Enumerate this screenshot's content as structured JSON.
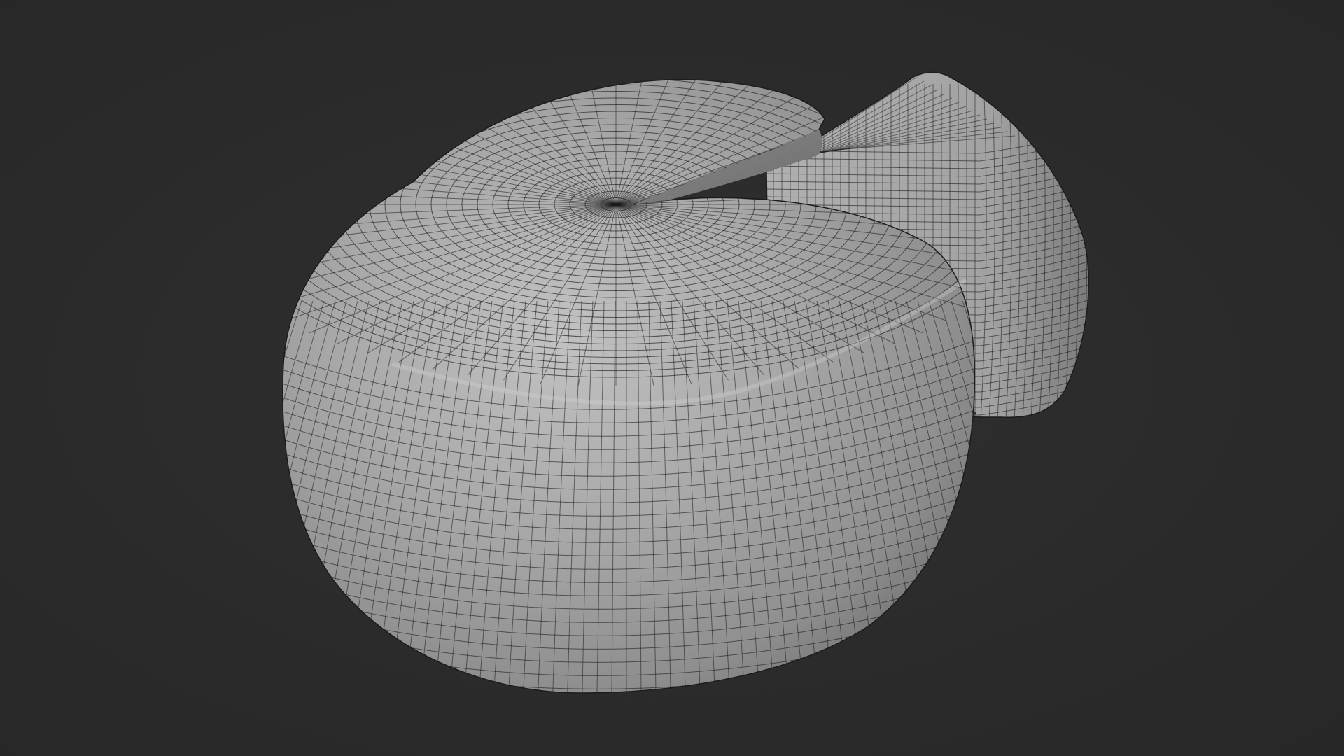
{
  "scene": {
    "background_color": "#2b2b2b",
    "mesh_color": "#9c9c9c",
    "wireframe_color": "#1a1a1a",
    "objects": [
      {
        "name": "cheese-wheel-cut",
        "shading": "solid",
        "overlay": "wireframe"
      },
      {
        "name": "cheese-wedge",
        "shading": "solid",
        "overlay": "wireframe"
      }
    ]
  }
}
